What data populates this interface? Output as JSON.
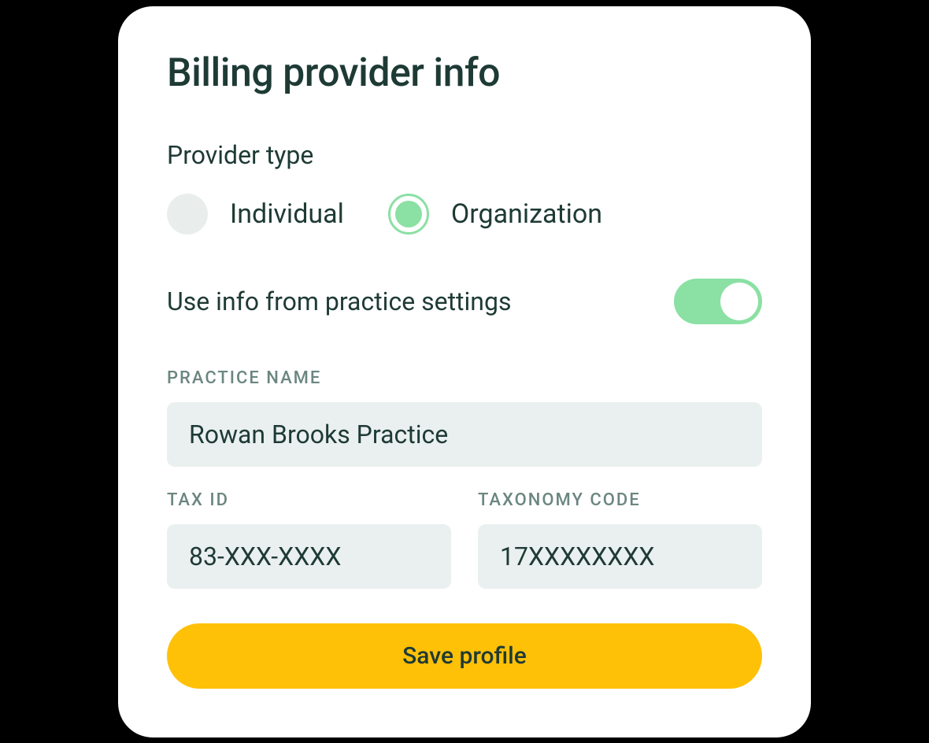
{
  "title": "Billing provider info",
  "providerType": {
    "label": "Provider type",
    "options": {
      "individual": "Individual",
      "organization": "Organization"
    },
    "selected": "organization"
  },
  "usePracticeSettings": {
    "label": "Use info from practice settings",
    "value": true
  },
  "fields": {
    "practiceName": {
      "label": "PRACTICE NAME",
      "value": "Rowan Brooks Practice"
    },
    "taxId": {
      "label": "TAX ID",
      "value": "83-XXX-XXXX"
    },
    "taxonomyCode": {
      "label": "TAXONOMY CODE",
      "value": "17XXXXXXXX"
    }
  },
  "saveButton": "Save profile",
  "colors": {
    "accent": "#8be0a4",
    "button": "#ffc107",
    "text": "#1e3a35",
    "muted": "#6b8680",
    "inputBg": "#eaf0ef"
  }
}
